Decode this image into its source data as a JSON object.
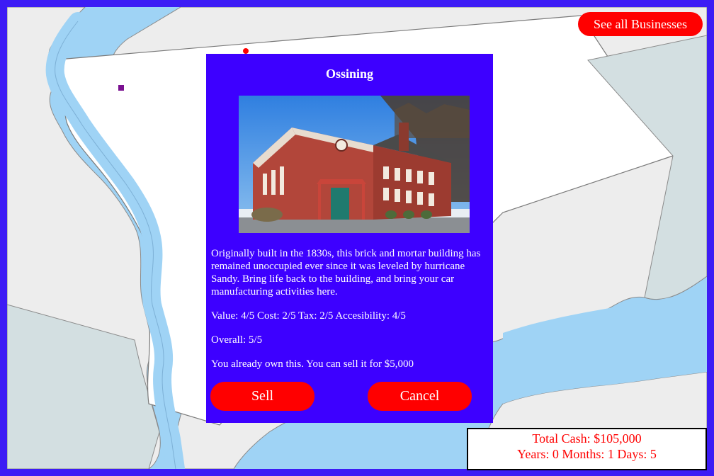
{
  "header": {
    "see_all_label": "See all Businesses"
  },
  "modal": {
    "title": "Ossining",
    "photo_alt": "Ossining brick building",
    "description": "Originally built in the 1830s, this brick and mortar building has remained unoccupied ever since it was leveled by hurricane Sandy. Bring life back to the building, and bring your car manufacturing activities here.",
    "stats": "Value: 4/5 Cost: 2/5 Tax: 2/5 Accesibility: 4/5",
    "overall": "Overall: 5/5",
    "ownership": "You already own this. You can sell it for $5,000",
    "sell_label": "Sell",
    "cancel_label": "Cancel"
  },
  "status": {
    "cash": "Total Cash: $105,000",
    "time": "Years: 0 Months: 1 Days: 5"
  },
  "colors": {
    "frame": "#3d1cf5",
    "modal_bg": "#3d00ff",
    "button": "#ff0000",
    "status_text": "#ff0000",
    "water": "#9fd3f5",
    "land": "#ededed",
    "region": "#ffffff"
  },
  "icons": {
    "marker_red": "map-marker-dot",
    "marker_purple": "map-marker-square"
  }
}
